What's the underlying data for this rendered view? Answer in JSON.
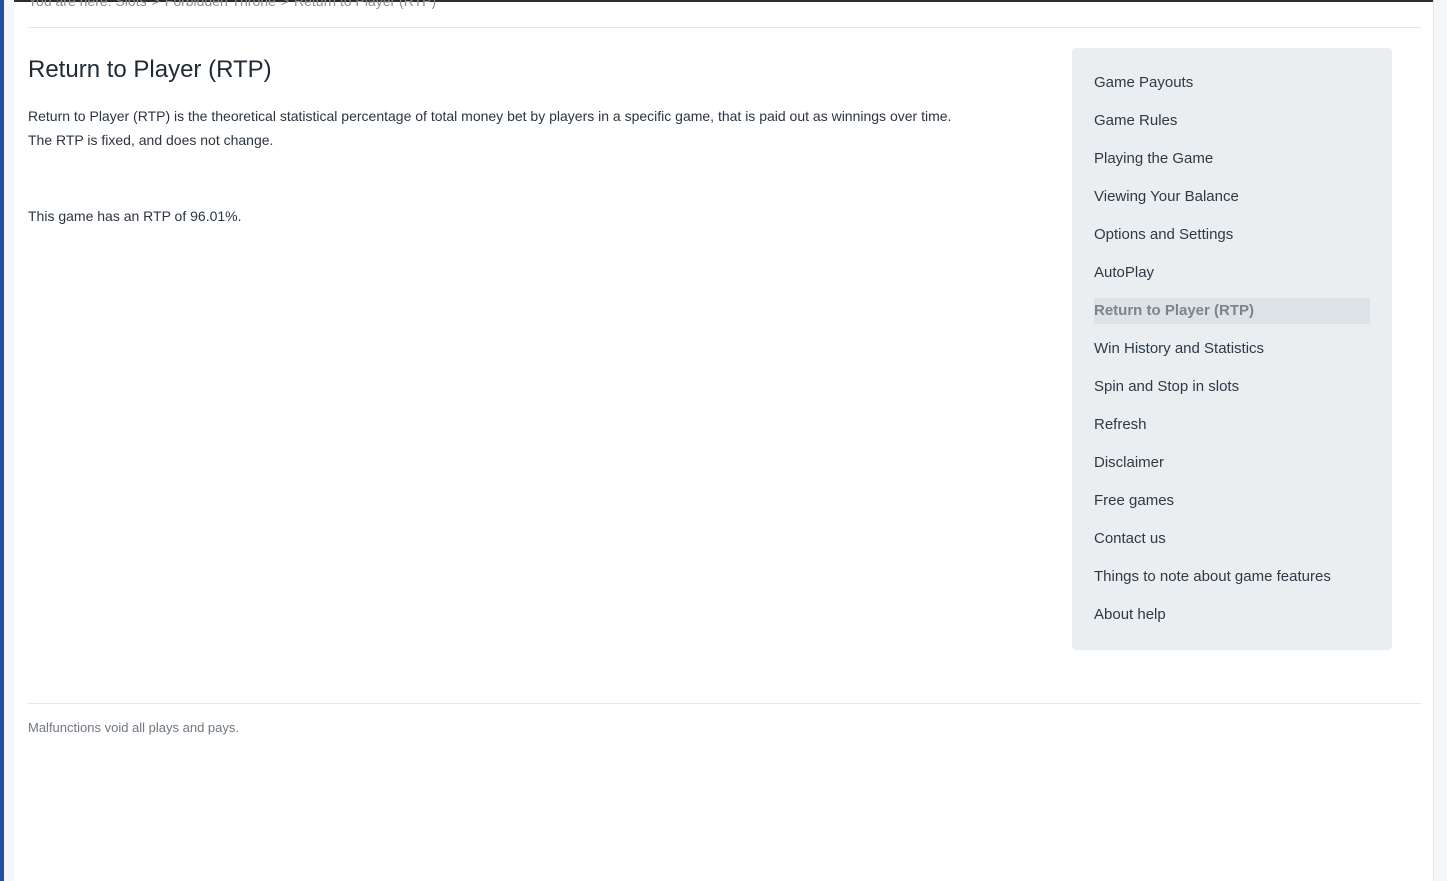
{
  "breadcrumb": {
    "prefix": "You are here:",
    "items": [
      "Slots",
      "Forbidden Throne",
      "Return to Player (RTP)"
    ],
    "separator": ">"
  },
  "content": {
    "title": "Return to Player (RTP)",
    "description": "Return to Player (RTP) is the theoretical statistical percentage of total money bet by players in a specific game, that is paid out as winnings over time. The RTP is fixed, and does not change.",
    "rtp_statement": "This game has an RTP of 96.01%."
  },
  "sidebar": {
    "items": [
      {
        "label": "Game Payouts"
      },
      {
        "label": "Game Rules"
      },
      {
        "label": "Playing the Game"
      },
      {
        "label": "Viewing Your Balance"
      },
      {
        "label": "Options and Settings"
      },
      {
        "label": "AutoPlay"
      },
      {
        "label": "Return to Player (RTP)",
        "active": true
      },
      {
        "label": "Win History and Statistics"
      },
      {
        "label": "Spin and Stop in slots"
      },
      {
        "label": "Refresh"
      },
      {
        "label": "Disclaimer"
      },
      {
        "label": "Free games"
      },
      {
        "label": "Contact us"
      },
      {
        "label": "Things to note about game features"
      },
      {
        "label": "About help"
      }
    ]
  },
  "footer": {
    "note": "Malfunctions void all plays and pays."
  },
  "colors": {
    "accent_left_edge": "#1d4fa3",
    "sidebar_bg": "#eaeef1",
    "active_item_bg": "#dde2e6"
  }
}
